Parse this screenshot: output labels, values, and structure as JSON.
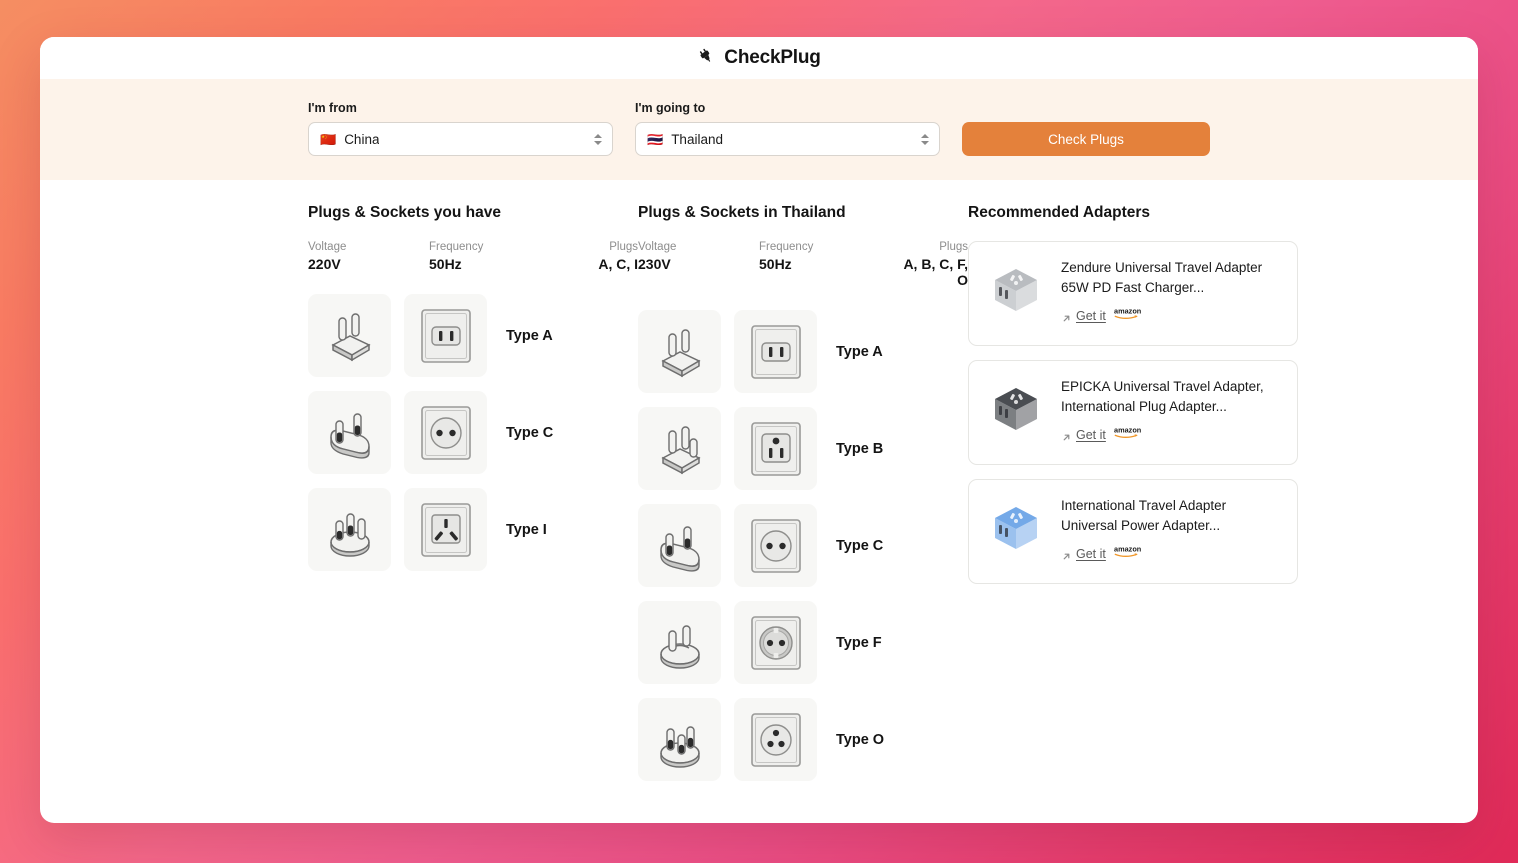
{
  "header": {
    "app_title": "CheckPlug",
    "logo_icon": "plug-icon"
  },
  "form": {
    "from_label": "I'm from",
    "from_value": "China",
    "from_flag": "🇨🇳",
    "to_label": "I'm going to",
    "to_value": "Thailand",
    "to_flag": "🇹🇭",
    "submit_label": "Check Plugs",
    "accent_color": "#e4813b",
    "strip_color": "#fdf3ea"
  },
  "source": {
    "title": "Plugs & Sockets you have",
    "specs": [
      {
        "label": "Voltage",
        "value": "220V"
      },
      {
        "label": "Frequency",
        "value": "50Hz"
      },
      {
        "label": "Plugs",
        "value": "A, C, I"
      }
    ],
    "plugs": [
      {
        "type": "Type A",
        "code": "A"
      },
      {
        "type": "Type C",
        "code": "C"
      },
      {
        "type": "Type I",
        "code": "I"
      }
    ]
  },
  "destination": {
    "title": "Plugs & Sockets in Thailand",
    "specs": [
      {
        "label": "Voltage",
        "value": "230V"
      },
      {
        "label": "Frequency",
        "value": "50Hz"
      },
      {
        "label": "Plugs",
        "value": "A, B, C, F, O"
      }
    ],
    "plugs": [
      {
        "type": "Type A",
        "code": "A"
      },
      {
        "type": "Type B",
        "code": "B"
      },
      {
        "type": "Type C",
        "code": "C"
      },
      {
        "type": "Type F",
        "code": "F"
      },
      {
        "type": "Type O",
        "code": "O"
      }
    ]
  },
  "adapters": {
    "title": "Recommended Adapters",
    "link_label": "Get it",
    "store": "amazon",
    "items": [
      {
        "name": "Zendure Universal Travel Adapter 65W PD Fast Charger...",
        "color": "#b9bcc0"
      },
      {
        "name": "EPICKA Universal Travel Adapter, International Plug Adapter...",
        "color": "#4a4d52"
      },
      {
        "name": "International Travel Adapter Universal Power Adapter...",
        "color": "#74a9e8"
      }
    ]
  }
}
